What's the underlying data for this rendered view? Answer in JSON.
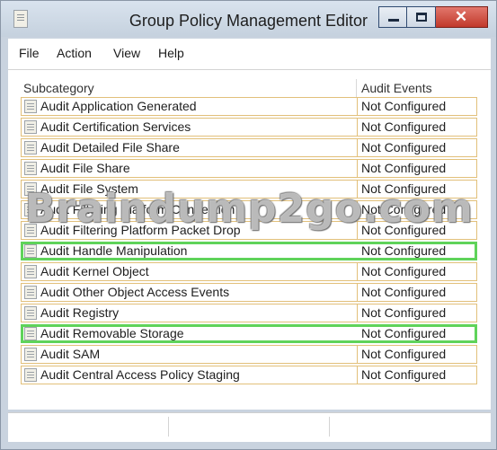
{
  "window": {
    "title": "Group Policy Management Editor",
    "close_glyph": "✕"
  },
  "menu": [
    {
      "label": "File"
    },
    {
      "label": "Action"
    },
    {
      "label": "View"
    },
    {
      "label": "Help"
    }
  ],
  "columns": {
    "subcategory": "Subcategory",
    "audit_events": "Audit Events"
  },
  "rows": [
    {
      "subcategory": "Audit Application Generated",
      "audit_events": "Not Configured",
      "highlighted": false
    },
    {
      "subcategory": "Audit Certification Services",
      "audit_events": "Not Configured",
      "highlighted": false
    },
    {
      "subcategory": "Audit Detailed File Share",
      "audit_events": "Not Configured",
      "highlighted": false
    },
    {
      "subcategory": "Audit File Share",
      "audit_events": "Not Configured",
      "highlighted": false
    },
    {
      "subcategory": "Audit File System",
      "audit_events": "Not Configured",
      "highlighted": false
    },
    {
      "subcategory": "Audit Filtering Platform Connection",
      "audit_events": "Not Configured",
      "highlighted": false
    },
    {
      "subcategory": "Audit Filtering Platform Packet Drop",
      "audit_events": "Not Configured",
      "highlighted": false
    },
    {
      "subcategory": "Audit Handle Manipulation",
      "audit_events": "Not Configured",
      "highlighted": true
    },
    {
      "subcategory": "Audit Kernel Object",
      "audit_events": "Not Configured",
      "highlighted": false
    },
    {
      "subcategory": "Audit Other Object Access Events",
      "audit_events": "Not Configured",
      "highlighted": false
    },
    {
      "subcategory": "Audit Registry",
      "audit_events": "Not Configured",
      "highlighted": false
    },
    {
      "subcategory": "Audit Removable Storage",
      "audit_events": "Not Configured",
      "highlighted": true
    },
    {
      "subcategory": "Audit SAM",
      "audit_events": "Not Configured",
      "highlighted": false
    },
    {
      "subcategory": "Audit Central Access Policy Staging",
      "audit_events": "Not Configured",
      "highlighted": false
    }
  ],
  "watermark": "Braindump2go.com",
  "colors": {
    "row_border": "#e2c07a",
    "highlight": "#5fd35a",
    "close_button": "#c9463a",
    "window_frame": "#c9d3df"
  }
}
